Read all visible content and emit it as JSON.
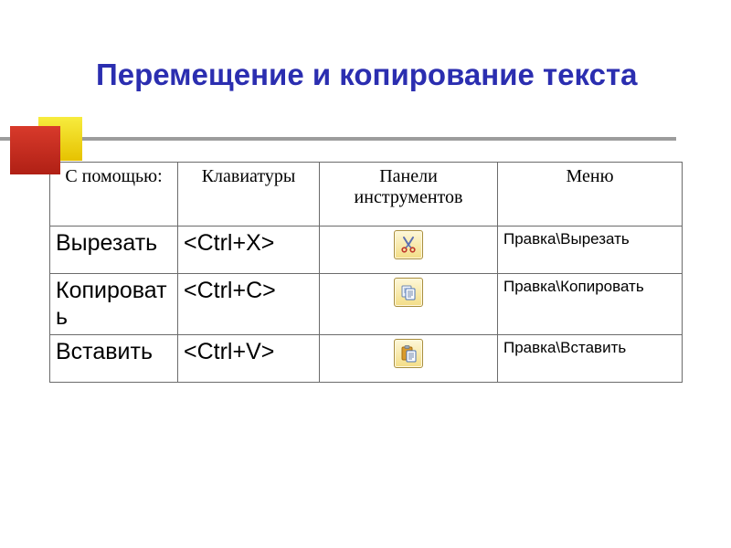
{
  "title": "Перемещение и копирование текста",
  "table": {
    "headers": {
      "help": "С помощью:",
      "keyboard": "Клавиатуры",
      "toolbar": "Панели инструментов",
      "menu": "Меню"
    },
    "rows": [
      {
        "action": "Вырезать",
        "shortcut": "<Ctrl+X>",
        "icon": "cut-icon",
        "menu": "Правка\\Вырезать"
      },
      {
        "action": "Копировать",
        "shortcut": "<Ctrl+C>",
        "icon": "copy-icon",
        "menu": "Правка\\Копировать"
      },
      {
        "action": "Вставить",
        "shortcut": "<Ctrl+V>",
        "icon": "paste-icon",
        "menu": "Правка\\Вставить"
      }
    ]
  }
}
